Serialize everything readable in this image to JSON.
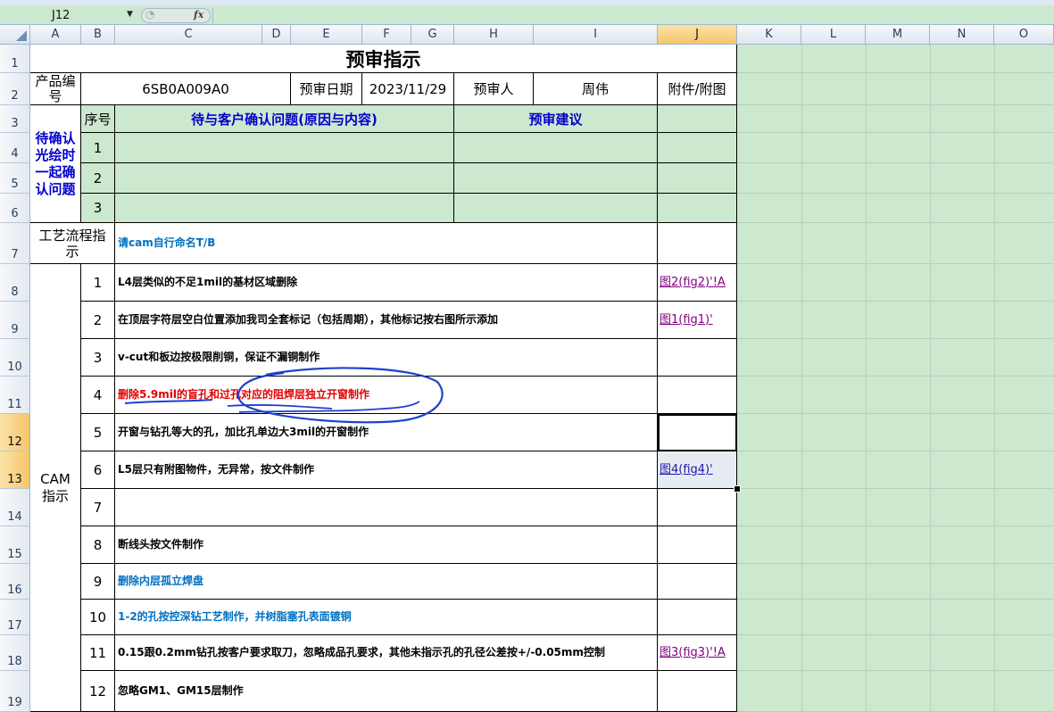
{
  "formula_bar": {
    "name_box": "J12",
    "fx_label": "fx",
    "formula_value": ""
  },
  "columns": [
    "A",
    "B",
    "C",
    "D",
    "E",
    "F",
    "G",
    "H",
    "I",
    "J",
    "K",
    "L",
    "M",
    "N",
    "O"
  ],
  "active_column": "J",
  "rows": [
    "1",
    "2",
    "3",
    "4",
    "5",
    "6",
    "7",
    "8",
    "9",
    "10",
    "11",
    "12",
    "13",
    "14",
    "15",
    "16",
    "17",
    "18",
    "19"
  ],
  "active_rows": [
    "12",
    "13"
  ],
  "sheet": {
    "title": "预审指示",
    "product_no_label": "产品编号",
    "product_no": "6SB0A009A0",
    "review_date_label": "预审日期",
    "review_date": "2023/11/29",
    "reviewer_label": "预审人",
    "reviewer": "周伟",
    "attachment_label": "附件/附图",
    "confirm_label": "待确认光绘时一起确认问题",
    "seq_label": "序号",
    "customer_issues_header": "待与客户确认问题(原因与内容)",
    "suggestion_header": "预审建议",
    "confirm_rows": [
      "1",
      "2",
      "3"
    ],
    "process_label": "工艺流程指示",
    "process_note": "请cam自行命名T/B",
    "cam_label": "CAM指示",
    "cam_items": [
      {
        "no": "1",
        "text": "L4层类似的不足1mil的基材区域删除",
        "link": "图2(fig2)'!A"
      },
      {
        "no": "2",
        "text": "在顶层字符层空白位置添加我司全套标记（包括周期），其他标记按右图所示添加",
        "link": "图1(fig1)'"
      },
      {
        "no": "3",
        "text": "v-cut和板边按极限削铜，保证不漏铜制作",
        "link": ""
      },
      {
        "no": "4",
        "text": "删除5.9mil的盲孔和过孔对应的阻焊层独立开窗制作",
        "link": ""
      },
      {
        "no": "5",
        "text": "开窗与钻孔等大的孔，加比孔单边大3mil的开窗制作",
        "link": ""
      },
      {
        "no": "6",
        "text": "L5层只有附图物件，无异常，按文件制作",
        "link": "图4(fig4)'"
      },
      {
        "no": "7",
        "text": "",
        "link": ""
      },
      {
        "no": "8",
        "text": "断线头按文件制作",
        "link": ""
      },
      {
        "no": "9",
        "text": "删除内层孤立焊盘",
        "link": ""
      },
      {
        "no": "10",
        "text": "1-2的孔按控深钻工艺制作，并树脂塞孔表面镀铜",
        "link": ""
      },
      {
        "no": "11",
        "text": "0.15跟0.2mm钻孔按客户要求取刀，忽略成品孔要求，其他未指示孔的孔径公差按+/-0.05mm控制",
        "link": "图3(fig3)'!A"
      },
      {
        "no": "12",
        "text": "忽略GM1、GM15层制作",
        "link": ""
      }
    ]
  },
  "colors": {
    "sheet_background": "#cce8cf",
    "active_header": "#f5c66a",
    "highlight_text_red": "#e00000",
    "highlight_text_blue": "#0070c0",
    "label_blue": "#0000cc",
    "annotation_ink": "#1f3fd0"
  }
}
